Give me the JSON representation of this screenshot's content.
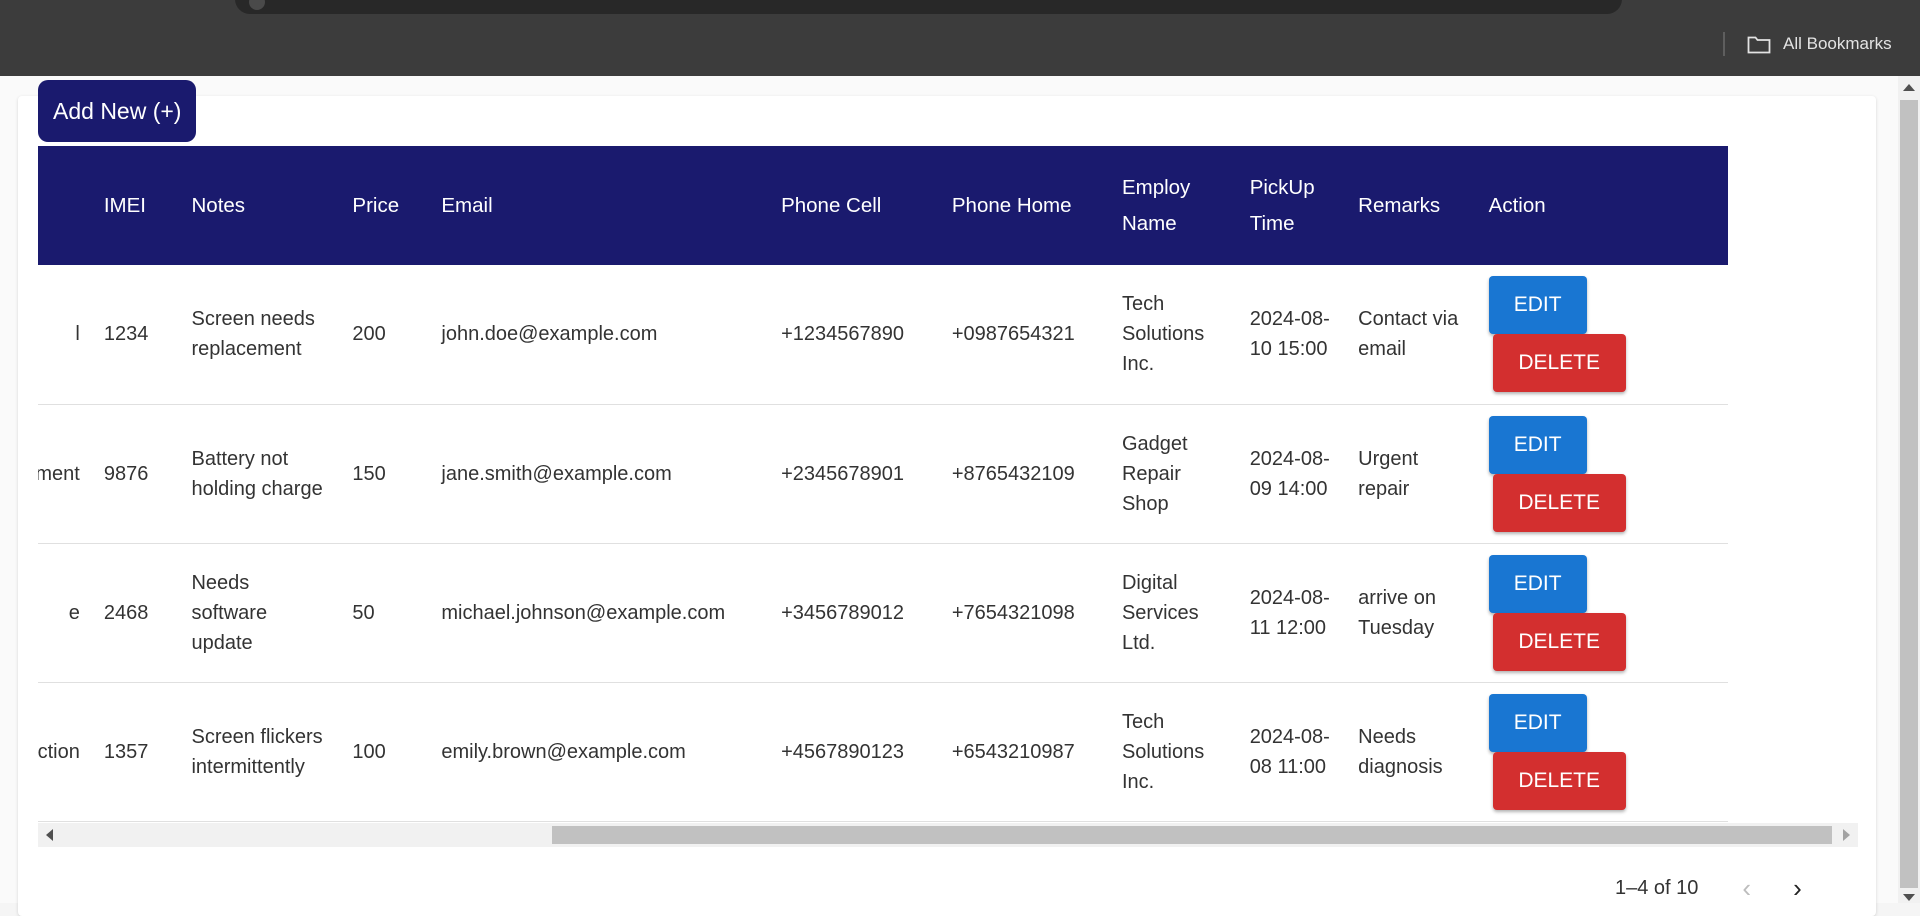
{
  "browser": {
    "bookmarks_label": "All Bookmarks"
  },
  "toolbar": {
    "add_label": "Add New (+)"
  },
  "table": {
    "headers": [
      "",
      "IMEI",
      "Notes",
      "Price",
      "Email",
      "Phone Cell",
      "Phone Home",
      "Employ Name",
      "PickUp Time",
      "Remarks",
      "Action"
    ],
    "rows": [
      {
        "partial": "l",
        "imei": "1234",
        "notes": "Screen needs replacement",
        "price": "200",
        "email": "john.doe@example.com",
        "phone_cell": "+1234567890",
        "phone_home": "+0987654321",
        "employ": "Tech Solutions Inc.",
        "pickup": "2024-08-10 15:00",
        "remarks": "Contact via email"
      },
      {
        "partial": "ement",
        "imei": "9876",
        "notes": "Battery not holding charge",
        "price": "150",
        "email": "jane.smith@example.com",
        "phone_cell": "+2345678901",
        "phone_home": "+8765432109",
        "employ": "Gadget Repair Shop",
        "pickup": "2024-08-09 14:00",
        "remarks": "Urgent repair"
      },
      {
        "partial": "e",
        "imei": "2468",
        "notes": "Needs software update",
        "price": "50",
        "email": "michael.johnson@example.com",
        "phone_cell": "+3456789012",
        "phone_home": "+7654321098",
        "employ": "Digital Services Ltd.",
        "pickup": "2024-08-11 12:00",
        "remarks": "arrive on Tuesday"
      },
      {
        "partial": "ction",
        "imei": "1357",
        "notes": "Screen flickers intermittently",
        "price": "100",
        "email": "emily.brown@example.com",
        "phone_cell": "+4567890123",
        "phone_home": "+6543210987",
        "employ": "Tech Solutions Inc.",
        "pickup": "2024-08-08 11:00",
        "remarks": "Needs diagnosis"
      }
    ],
    "edit_label": "EDIT",
    "delete_label": "DELETE"
  },
  "pagination": {
    "range_text": "1–4 of 10"
  },
  "colors": {
    "header_bg": "#1a1a6e",
    "edit": "#1976d2",
    "delete": "#d32f2f"
  },
  "icons": {
    "bookmarks": "folder-icon",
    "prev": "chevron-left-icon",
    "next": "chevron-right-icon"
  }
}
